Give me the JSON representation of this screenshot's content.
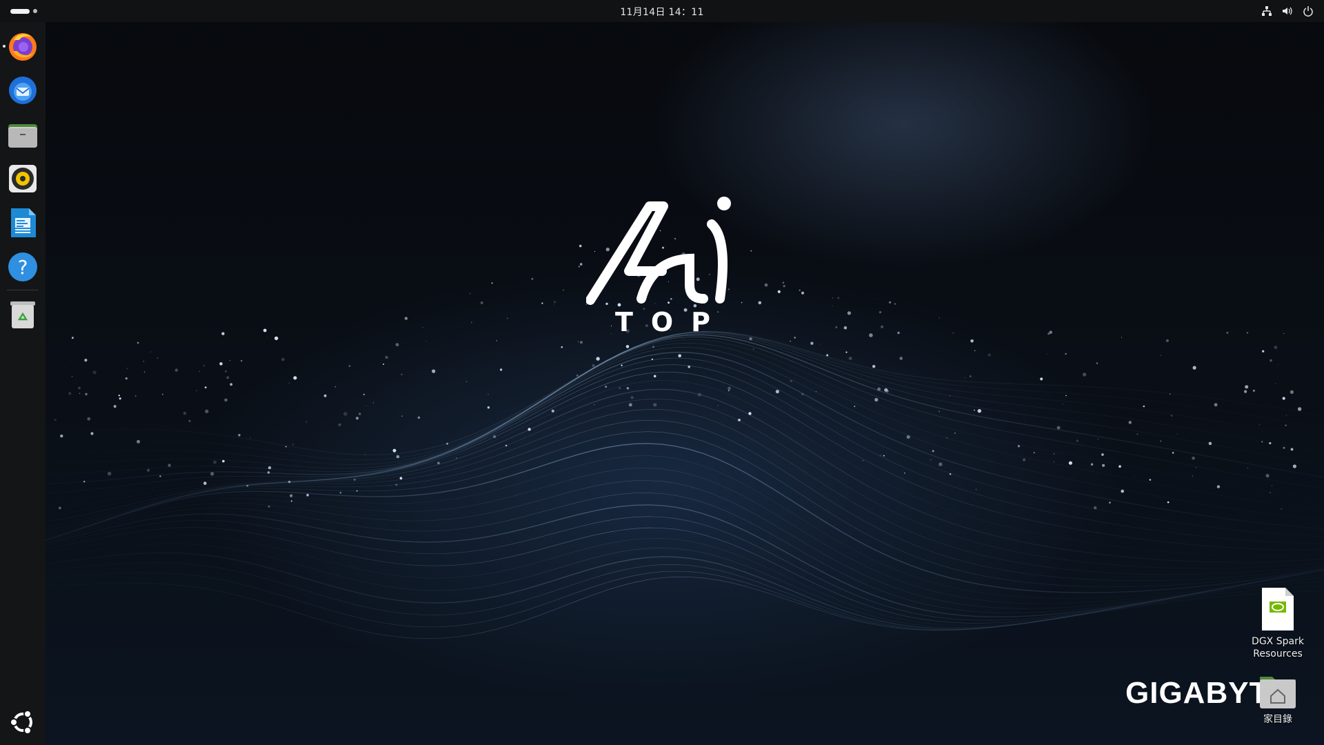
{
  "topbar": {
    "clock": "11月14日 14：11",
    "tray_icons": [
      "network-icon",
      "volume-icon",
      "power-icon"
    ]
  },
  "dock": {
    "items": [
      {
        "name": "firefox-icon",
        "running": true
      },
      {
        "name": "thunderbird-icon",
        "running": false
      },
      {
        "name": "files-icon",
        "running": false
      },
      {
        "name": "rhythmbox-icon",
        "running": false
      },
      {
        "name": "libreoffice-writer-icon",
        "running": false
      },
      {
        "name": "help-icon",
        "running": false
      },
      {
        "name": "trash-icon",
        "running": false
      }
    ],
    "show_apps": "ubuntu-apps-icon"
  },
  "wallpaper": {
    "logo_top_text": "TOP",
    "brand_text": "GIGABYTE"
  },
  "desktop_icons": [
    {
      "label_line1": "DGX Spark",
      "label_line2": "Resources",
      "icon": "nvidia-document-icon"
    },
    {
      "label_line1": "家目錄",
      "icon": "home-folder-icon"
    }
  ],
  "colors": {
    "topbar": "#111213",
    "dock": "#141516",
    "wave_accent": "#8fb6e6"
  }
}
